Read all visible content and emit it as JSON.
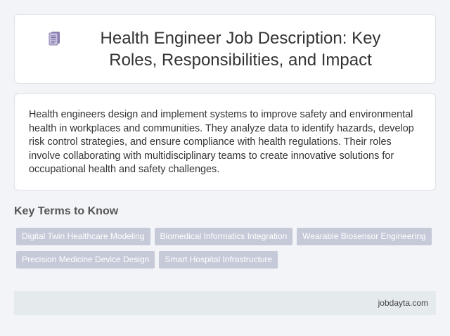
{
  "header": {
    "icon": "document-icon",
    "title": "Health Engineer Job Description: Key Roles, Responsibilities, and Impact"
  },
  "description": {
    "text": "Health engineers design and implement systems to improve safety and environmental health in workplaces and communities. They analyze data to identify hazards, develop risk control strategies, and ensure compliance with health regulations. Their roles involve collaborating with multidisciplinary teams to create innovative solutions for occupational health and safety challenges."
  },
  "key_terms": {
    "heading": "Key Terms to Know",
    "items": [
      "Digital Twin Healthcare Modeling",
      "Biomedical Informatics Integration",
      "Wearable Biosensor Engineering",
      "Precision Medicine Device Design",
      "Smart Hospital Infrastructure"
    ]
  },
  "footer": {
    "site": "jobdayta.com"
  },
  "colors": {
    "background": "#f3f4f8",
    "tag_bg": "#c6cad8",
    "footer_bg": "#e5eaed"
  }
}
